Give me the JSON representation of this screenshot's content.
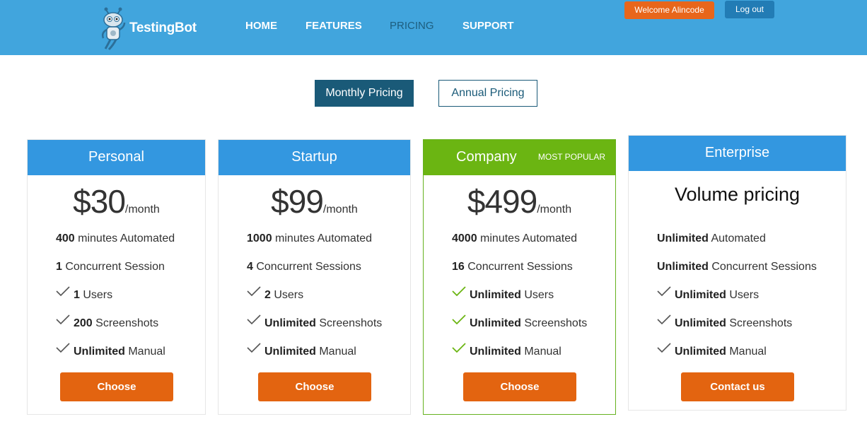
{
  "header": {
    "logo_text": "TestingBot",
    "nav": [
      "HOME",
      "FEATURES",
      "PRICING",
      "SUPPORT"
    ],
    "active_nav": "PRICING",
    "welcome": "Welcome Alincode",
    "logout": "Log out"
  },
  "toggle": {
    "monthly": "Monthly Pricing",
    "annual": "Annual Pricing"
  },
  "plans": [
    {
      "name": "Personal",
      "price": "$30",
      "period": "/month",
      "f1_bold": "400",
      "f1": " minutes Automated",
      "f2_bold": "1",
      "f2": " Concurrent Session",
      "f3_bold": "1",
      "f3": " Users",
      "f4_bold": "200",
      "f4": " Screenshots",
      "f5_bold": "Unlimited",
      "f5": " Manual",
      "cta": "Choose"
    },
    {
      "name": "Startup",
      "price": "$99",
      "period": "/month",
      "f1_bold": "1000",
      "f1": " minutes Automated",
      "f2_bold": "4",
      "f2": " Concurrent Sessions",
      "f3_bold": "2",
      "f3": " Users",
      "f4_bold": "Unlimited",
      "f4": " Screenshots",
      "f5_bold": "Unlimited",
      "f5": " Manual",
      "cta": "Choose"
    },
    {
      "name": "Company",
      "badge": "MOST POPULAR",
      "price": "$499",
      "period": "/month",
      "f1_bold": "4000",
      "f1": " minutes Automated",
      "f2_bold": "16",
      "f2": " Concurrent Sessions",
      "f3_bold": "Unlimited",
      "f3": " Users",
      "f4_bold": "Unlimited",
      "f4": " Screenshots",
      "f5_bold": "Unlimited",
      "f5": " Manual",
      "cta": "Choose"
    },
    {
      "name": "Enterprise",
      "price": "Volume pricing",
      "f1_bold": "Unlimited",
      "f1": " Automated",
      "f2_bold": "Unlimited",
      "f2": " Concurrent Sessions",
      "f3_bold": "Unlimited",
      "f3": " Users",
      "f4_bold": "Unlimited",
      "f4": " Screenshots",
      "f5_bold": "Unlimited",
      "f5": " Manual",
      "cta": "Contact us"
    }
  ],
  "colors": {
    "header_bg": "#41a5dd",
    "plan_head": "#3397e0",
    "popular_head": "#6bb512",
    "cta": "#e36410",
    "toggle_active": "#1a5a78",
    "check_default": "#555555",
    "check_popular": "#6bb512"
  },
  "icons": {
    "logo": "robot-mascot-icon",
    "check": "checkmark-icon"
  }
}
